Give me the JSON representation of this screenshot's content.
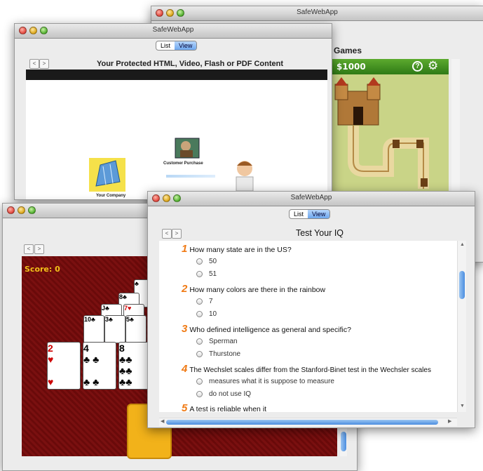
{
  "back_window": {
    "title": "SafeWebApp",
    "header_title": "Games",
    "money": "$1000"
  },
  "mid_window": {
    "title": "SafeWebApp",
    "seg_list": "List",
    "seg_view": "View",
    "header_title": "Your Protected HTML, Video, Flash or PDF Content",
    "customer_label": "Customer Purchase",
    "company_label": "Your Company"
  },
  "cards_window": {
    "score_label": "Score: 0"
  },
  "front_window": {
    "title": "SafeWebApp",
    "seg_list": "List",
    "seg_view": "View",
    "header_title": "Test Your IQ",
    "questions": [
      {
        "num": "1",
        "text": "How many state are in the US?",
        "options": [
          "50",
          "51"
        ]
      },
      {
        "num": "2",
        "text": "How many colors are there in the rainbow",
        "options": [
          "7",
          "10"
        ]
      },
      {
        "num": "3",
        "text": "Who defined intelligence as general and specific?",
        "options": [
          "Sperman",
          "Thurstone"
        ]
      },
      {
        "num": "4",
        "text": "The Wechslet scales differ from the Stanford-Binet test in the Wechsler scales",
        "options": [
          "measures what it is suppose to measure",
          "do not use IQ"
        ]
      },
      {
        "num": "5",
        "text": "A test is reliable when it",
        "options": []
      }
    ]
  },
  "colors": {
    "accent_orange": "#f07a14",
    "card_table": "#7a1010",
    "game_green": "#3f8f1f"
  }
}
